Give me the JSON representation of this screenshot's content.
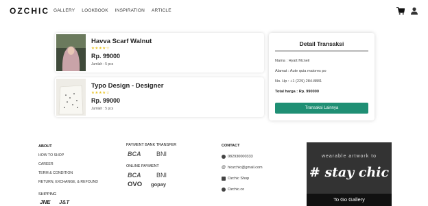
{
  "header": {
    "logo": "OZCHIC",
    "nav": [
      "GALLERY",
      "LOOKBOOK",
      "INSPIRATION",
      "ARTICLE"
    ],
    "icons": [
      "cart-icon",
      "user-icon"
    ]
  },
  "products": [
    {
      "name": "Havva Scarf Walnut",
      "stars": "★★★★☆",
      "price": "Rp. 99000",
      "quantity": "Jumlah : 5 pcs"
    },
    {
      "name": "Typo Design - Designer",
      "stars": "★★★★☆",
      "price": "Rp. 99000",
      "quantity": "Jumlah : 5 pcs"
    }
  ],
  "detail": {
    "title": "Detail Transaksi",
    "name_label": "Nama : ",
    "name_value": "Hyatt Mcneil",
    "address_label": "Alamat : ",
    "address_value": "Aute quia maiores po",
    "phone_label": "No. Hp : ",
    "phone_value": "+1 (229) 284-8881",
    "total_label": "Total harga : ",
    "total_value": "Rp. 990000",
    "button": "Transaksi Lainnya",
    "accent": "#1f8f74"
  },
  "footer": {
    "about_heading": "ABOUT",
    "about_links": [
      "HOW TO SHOP",
      "CAREER",
      "TERM & CONDITION",
      "RETURN, EXCHANGE, & REFOUND"
    ],
    "shipping_heading": "SHIPPING",
    "shipping_logos": [
      "JNE",
      "J&T"
    ],
    "bank_heading": "PAYMENT BANK TRANSFER",
    "bank_logos": [
      "BCA",
      "BNI"
    ],
    "online_heading": "ONLINE PAYMENT",
    "online_logos": [
      "BCA",
      "BNI",
      "OVO",
      "gopay"
    ],
    "contact_heading": "CONTACT",
    "contacts": [
      "082930000333",
      "hiozchic@gmail.com",
      "Ozchic Shop",
      "Ozchic.co"
    ],
    "promo_top": "wearable artwork to",
    "promo_big": "# stay chic",
    "gallery_button": "To Go Gallery"
  }
}
